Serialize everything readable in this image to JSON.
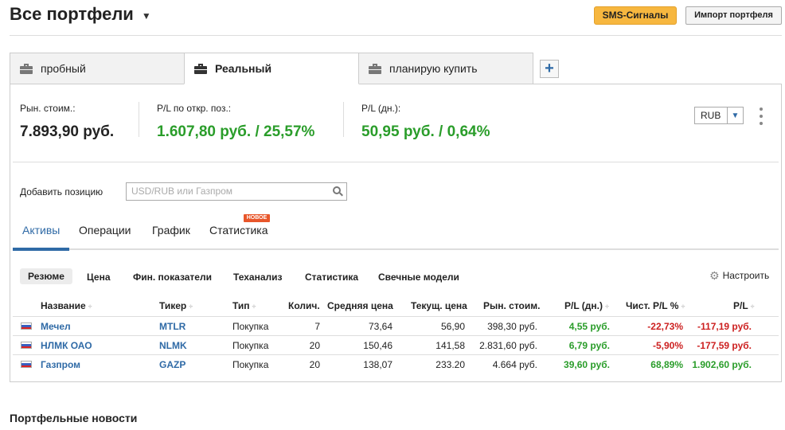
{
  "header": {
    "title": "Все портфели",
    "sms_button": "SMS-Сигналы",
    "import_button": "Импорт портфеля"
  },
  "tabs": [
    {
      "label": "пробный",
      "active": false
    },
    {
      "label": "Реальный",
      "active": true
    },
    {
      "label": "планирую купить",
      "active": false
    }
  ],
  "add_tab_label": "+",
  "summary": {
    "market_value_label": "Рын. стоим.:",
    "market_value": "7.893,90 руб.",
    "pl_open_label": "P/L по откр. поз.:",
    "pl_open": "1.607,80 руб. / 25,57%",
    "pl_day_label": "P/L (дн.):",
    "pl_day": "50,95 руб. / 0,64%",
    "currency": "RUB"
  },
  "add_position": {
    "label": "Добавить позицию",
    "placeholder": "USD/RUB или Газпром"
  },
  "subtabs": [
    {
      "label": "Активы",
      "active": true
    },
    {
      "label": "Операции",
      "active": false
    },
    {
      "label": "График",
      "active": false
    },
    {
      "label": "Статистика",
      "active": false,
      "badge": "НОВОЕ"
    }
  ],
  "filters": [
    {
      "label": "Резюме",
      "active": true
    },
    {
      "label": "Цена",
      "active": false
    },
    {
      "label": "Фин. показатели",
      "active": false
    },
    {
      "label": "Теханализ",
      "active": false
    },
    {
      "label": "Статистика",
      "active": false
    },
    {
      "label": "Свечные модели",
      "active": false
    }
  ],
  "settings_label": "Настроить",
  "table": {
    "columns": [
      "Название",
      "Тикер",
      "Тип",
      "Колич.",
      "Средняя цена",
      "Текущ. цена",
      "Рын. стоим.",
      "P/L (дн.)",
      "Чист. P/L %",
      "P/L"
    ],
    "sort_glyph": "÷",
    "rows": [
      {
        "name": "Мечел",
        "ticker": "MTLR",
        "type": "Покупка",
        "qty": "7",
        "avg_price": "73,64",
        "cur_price": "56,90",
        "market_value": "398,30 руб.",
        "pl_day": "4,55 руб.",
        "net_pl_pct": "-22,73%",
        "pl": "-117,19 руб."
      },
      {
        "name": "НЛМК ОАО",
        "ticker": "NLMK",
        "type": "Покупка",
        "qty": "20",
        "avg_price": "150,46",
        "cur_price": "141,58",
        "market_value": "2.831,60 руб.",
        "pl_day": "6,79 руб.",
        "net_pl_pct": "-5,90%",
        "pl": "-177,59 руб."
      },
      {
        "name": "Газпром",
        "ticker": "GAZP",
        "type": "Покупка",
        "qty": "20",
        "avg_price": "138,07",
        "cur_price": "233.20",
        "market_value": "4.664 руб.",
        "pl_day": "39,60 руб.",
        "net_pl_pct": "68,89%",
        "pl": "1.902,60 руб."
      }
    ]
  },
  "news_title": "Портфельные новости",
  "colors": {
    "accent": "#2f6aa6",
    "positive": "#2a9d2a",
    "negative": "#cc1f1f",
    "sms": "#f7b73f",
    "badge": "#e8562a"
  }
}
